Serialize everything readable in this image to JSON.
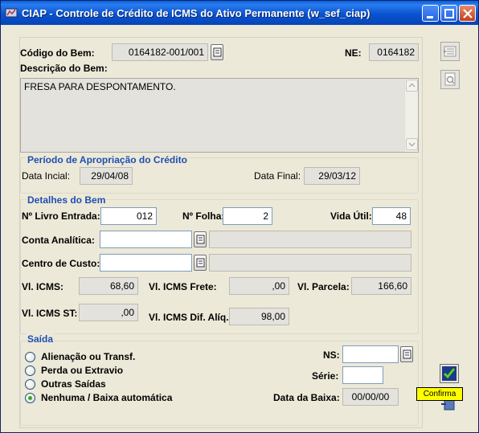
{
  "window": {
    "title": "CIAP - Controle de Crédito de ICMS do Ativo Permanente (w_sef_ciap)"
  },
  "bem": {
    "codigo_label": "Código do Bem:",
    "codigo_value": "0164182-001/001",
    "ne_label": "NE:",
    "ne_value": "0164182",
    "descricao_label": "Descrição do Bem:",
    "descricao_value": "FRESA PARA DESPONTAMENTO."
  },
  "periodo": {
    "title": "Período de Apropriação do Crédito",
    "inicial_label": "Data Incial:",
    "inicial_value": "29/04/08",
    "final_label": "Data Final:",
    "final_value": "29/03/12"
  },
  "detalhes": {
    "title": "Detalhes do Bem",
    "livro_label": "Nº Livro Entrada:",
    "livro_value": "012",
    "folha_label": "Nº Folha:",
    "folha_value": "2",
    "vida_label": "Vida Útil:",
    "vida_value": "48",
    "conta_label": "Conta Analítica:",
    "conta_value": "",
    "custo_label": "Centro de Custo:",
    "custo_value": "",
    "icms_label": "Vl. ICMS:",
    "icms_value": "68,60",
    "frete_label": "Vl. ICMS Frete:",
    "frete_value": ",00",
    "parcela_label": "Vl. Parcela:",
    "parcela_value": "166,60",
    "st_label": "Vl. ICMS ST:",
    "st_value": ",00",
    "difaliq_label": "Vl. ICMS Dif. Alíq.:",
    "difaliq_value": "98,00"
  },
  "saida": {
    "title": "Saída",
    "options": [
      {
        "label": "Alienação ou Transf.",
        "selected": false
      },
      {
        "label": "Perda ou Extravio",
        "selected": false
      },
      {
        "label": "Outras Saídas",
        "selected": false
      },
      {
        "label": "Nenhuma / Baixa automática",
        "selected": true
      }
    ],
    "ns_label": "NS:",
    "ns_value": "",
    "serie_label": "Série:",
    "serie_value": "",
    "baixa_label": "Data da Baixa:",
    "baixa_value": "00/00/00"
  },
  "tooltip": {
    "text": "Confirma"
  },
  "colors": {
    "section": "#1f4fb0",
    "titlebar": "#0a53d0",
    "tooltip": "#ffff00"
  },
  "icons": [
    "app-icon",
    "minimize-icon",
    "maximize-icon",
    "close-icon",
    "lookup-icon",
    "list-icon",
    "preview-icon",
    "confirm-icon",
    "exit-icon"
  ]
}
